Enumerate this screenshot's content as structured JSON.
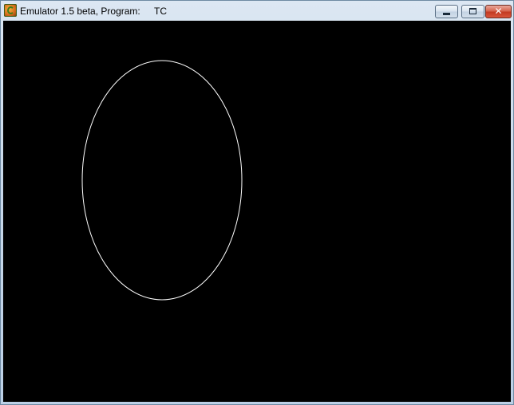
{
  "window": {
    "title": "Emulator 1.5 beta, Program:",
    "program": "TC",
    "app_icon": "emulator-app-icon",
    "controls": {
      "minimize_icon": "minimize-icon",
      "maximize_icon": "maximize-icon",
      "close_icon": "close-icon",
      "close_glyph": "✕"
    }
  },
  "canvas": {
    "background": "#000000",
    "shape": "ellipse",
    "stroke_color": "#ffffff"
  }
}
